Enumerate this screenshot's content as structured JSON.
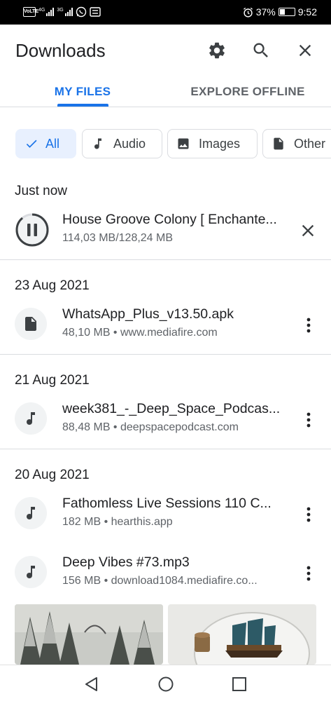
{
  "status_bar": {
    "left_icons": [
      "volte-icon",
      "signal-4g-icon",
      "signal-3g-icon",
      "whatsapp-icon",
      "gallery-icon"
    ],
    "net_4g": "4G",
    "net_3g": "3G",
    "volte": "VoLTE",
    "alarm_icon": "alarm-icon",
    "battery_percent": "37%",
    "battery_level": 0.37,
    "time": "9:52"
  },
  "app_bar": {
    "title": "Downloads",
    "actions": [
      "settings-icon",
      "search-icon",
      "close-icon"
    ]
  },
  "tabs": [
    {
      "label": "MY FILES",
      "selected": true
    },
    {
      "label": "EXPLORE OFFLINE",
      "selected": false
    }
  ],
  "filters": [
    {
      "label": "All",
      "icon": "check-icon",
      "selected": true
    },
    {
      "label": "Audio",
      "icon": "music-note-icon",
      "selected": false
    },
    {
      "label": "Images",
      "icon": "image-icon",
      "selected": false
    },
    {
      "label": "Other",
      "icon": "file-icon",
      "selected": false
    }
  ],
  "sections": [
    {
      "header": "Just now",
      "items": [
        {
          "title": "House Groove Colony [ Enchante...",
          "subtitle": "114,03 MB/128,24 MB",
          "icon": "pause-icon",
          "action": "close-icon",
          "progress": 0.889
        }
      ]
    },
    {
      "header": "23 Aug 2021",
      "items": [
        {
          "title": "WhatsApp_Plus_v13.50.apk",
          "subtitle": "48,10 MB • www.mediafire.com",
          "icon": "file-icon",
          "action": "more-vert-icon"
        }
      ]
    },
    {
      "header": "21 Aug 2021",
      "items": [
        {
          "title": "week381_-_Deep_Space_Podcas...",
          "subtitle": "88,48 MB • deepspacepodcast.com",
          "icon": "music-note-icon",
          "action": "more-vert-icon"
        }
      ]
    },
    {
      "header": "20 Aug 2021",
      "items": [
        {
          "title": "Fathomless Live Sessions 110 C...",
          "subtitle": "182 MB • hearthis.app",
          "icon": "music-note-icon",
          "action": "more-vert-icon"
        },
        {
          "title": "Deep Vibes #73.mp3",
          "subtitle": "156 MB • download1084.mediafire.co...",
          "icon": "music-note-icon",
          "action": "more-vert-icon"
        }
      ]
    }
  ],
  "image_previews": [
    "snowy-forest-image",
    "ship-in-bottle-image"
  ],
  "nav_bar": [
    "back-icon",
    "home-icon",
    "recents-icon"
  ],
  "colors": {
    "accent": "#1a73e8",
    "chip_selected_bg": "#e8f0fe",
    "text_primary": "#202124",
    "text_secondary": "#5f6368",
    "divider": "#dadce0"
  }
}
